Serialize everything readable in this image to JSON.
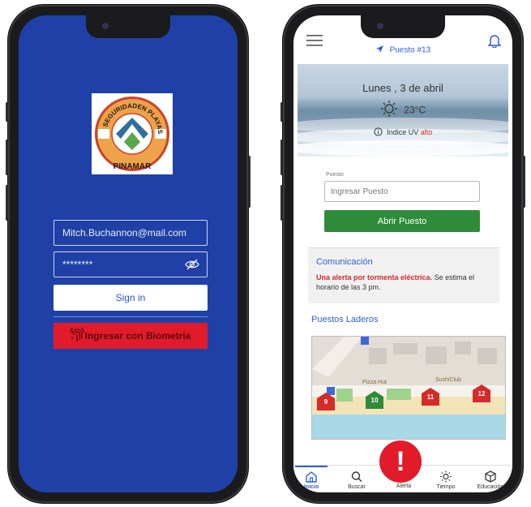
{
  "login": {
    "logo": {
      "top_text": "EN PLAYAS",
      "left_text": "SEGURIDAD",
      "bottom_text": "PINAMAR",
      "colors": {
        "ring": "#f0a24a",
        "ring_border": "#c8442a",
        "mountain": "#2f6f9c",
        "water": "#56a84a"
      }
    },
    "email_value": "Mitch.Buchannon@mail.com",
    "password_value": "********",
    "signin_label": "Sign in",
    "biometric_label": "Ingresar con Biometria",
    "colors": {
      "background": "#1f40a6",
      "biometric": "#e21b2b"
    }
  },
  "app": {
    "header": {
      "title": "Puesto #13",
      "menu_icon": "menu-icon",
      "nav_icon": "navigation-icon",
      "bell_icon": "bell-icon"
    },
    "weather": {
      "date": "Lunes , 3 de abril",
      "temperature": "23°C",
      "uv_label": "Indice UV",
      "uv_value": "alto"
    },
    "puesto": {
      "field_label": "Puesto",
      "placeholder": "Ingresar Puesto",
      "button_label": "Abrir Puesto"
    },
    "communication": {
      "title": "Comunicación",
      "alert_bold": "Una alerta por tormenta eléctrica.",
      "alert_rest": " Se estima el horario de las 3 pm."
    },
    "nearby": {
      "title": "Puestos Laderos",
      "map_labels": [
        "Pizza Hut",
        "SushiClub"
      ],
      "markers": [
        {
          "number": "9",
          "color": "#d42a2a"
        },
        {
          "number": "10",
          "color": "#2e8b3a"
        },
        {
          "number": "11",
          "color": "#d42a2a"
        },
        {
          "number": "12",
          "color": "#d42a2a"
        }
      ]
    },
    "nav": [
      {
        "label": "Inicio",
        "icon": "home-icon",
        "active": true
      },
      {
        "label": "Buscar",
        "icon": "search-icon"
      },
      {
        "label": "Alerta",
        "icon": "alert-icon"
      },
      {
        "label": "Tiempo",
        "icon": "sun-icon"
      },
      {
        "label": "Educación",
        "icon": "cube-icon"
      }
    ],
    "alert_fab": "!",
    "colors": {
      "accent": "#2d5fd3",
      "alert": "#e21b2b",
      "green": "#2e8b3a"
    }
  }
}
